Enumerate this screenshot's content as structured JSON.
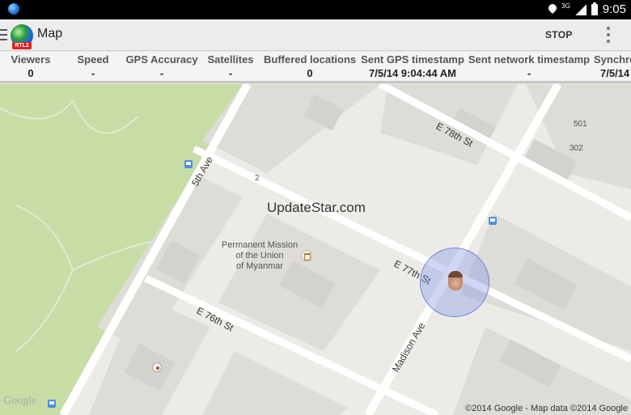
{
  "status_bar": {
    "network_label": "3G",
    "time": "9:05"
  },
  "action_bar": {
    "title": "Map",
    "stop_label": "STOP",
    "logo_text": "RTL2"
  },
  "stats": {
    "columns": [
      {
        "header": "Viewers",
        "value": "0"
      },
      {
        "header": "Speed",
        "value": "-"
      },
      {
        "header": "GPS Accuracy",
        "value": "-"
      },
      {
        "header": "Satellites",
        "value": "-"
      },
      {
        "header": "Buffered locations",
        "value": "0"
      },
      {
        "header": "Sent GPS timestamp",
        "value": "7/5/14 9:04:44 AM"
      },
      {
        "header": "Sent network timestamp",
        "value": "-"
      },
      {
        "header": "Synchro",
        "value": "7/5/14"
      }
    ]
  },
  "map": {
    "watermark": "UpdateStar.com",
    "poi": {
      "line1": "Permanent Mission",
      "line2": "of the Union",
      "line3": "of Myanmar"
    },
    "streets": {
      "e78": "E 78th St",
      "e77": "E 77th St",
      "e76": "E 76th St",
      "fifth": "5th Ave",
      "madison": "Madison Ave"
    },
    "building_numbers": {
      "b501": "501",
      "b302": "302",
      "b2": "2"
    },
    "google_logo": "Google",
    "attribution": "©2014 Google - Map data ©2014 Google",
    "colors": {
      "park": "#c8dca6",
      "land": "#ecebe6",
      "road": "#ffffff",
      "marker": "#7888e6"
    }
  }
}
